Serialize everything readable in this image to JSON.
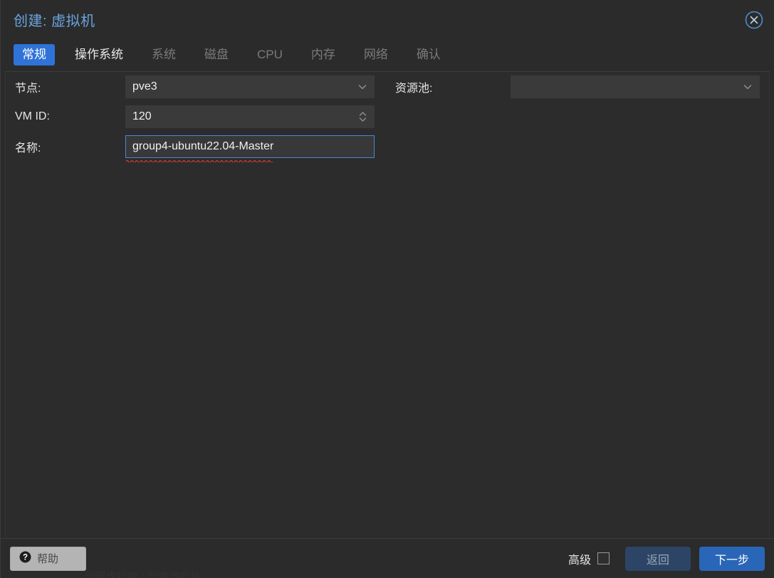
{
  "window": {
    "title": "创建: 虚拟机",
    "close_icon": "close-circle-icon"
  },
  "tabs": [
    {
      "label": "常规",
      "state": "active"
    },
    {
      "label": "操作系统",
      "state": "enabled"
    },
    {
      "label": "系统",
      "state": "disabled"
    },
    {
      "label": "磁盘",
      "state": "disabled"
    },
    {
      "label": "CPU",
      "state": "disabled"
    },
    {
      "label": "内存",
      "state": "disabled"
    },
    {
      "label": "网络",
      "state": "disabled"
    },
    {
      "label": "确认",
      "state": "disabled"
    }
  ],
  "form": {
    "node": {
      "label": "节点:",
      "value": "pve3",
      "icon": "chevron-down-icon"
    },
    "vmid": {
      "label": "VM ID:",
      "value": "120",
      "icon": "spinner-updown-icon"
    },
    "name": {
      "label": "名称:",
      "value": "group4-ubuntu22.04-Master",
      "placeholder": "",
      "focused": true,
      "spellcheck_underline": true
    },
    "pool": {
      "label": "资源池:",
      "value": "",
      "placeholder": "",
      "icon": "chevron-down-icon"
    }
  },
  "footer": {
    "help_label": "帮助",
    "help_icon": "question-circle-icon",
    "advanced_label": "高级",
    "advanced_checked": false,
    "back_label": "返回",
    "next_label": "下一步"
  },
  "background": {
    "ghost_text": "创建虚拟机 / 创建虚拟机"
  },
  "colors": {
    "accent_blue": "#2f73d8",
    "title_blue": "#6aa4e0",
    "next_button": "#2a66b8",
    "back_button": "#2c4566",
    "dialog_bg": "#2b2b2b",
    "field_bg": "#3a3a3a",
    "focus_border": "#4a86d8",
    "spell_error": "#e03c31",
    "help_bg": "#b4b4b4"
  }
}
